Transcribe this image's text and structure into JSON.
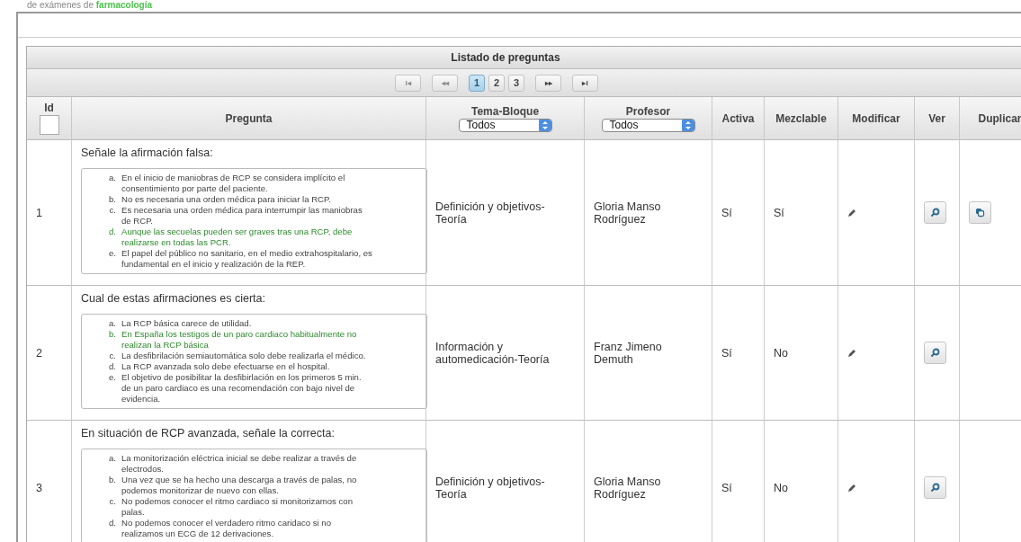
{
  "top_caption": {
    "text": "de exámenes de",
    "highlight": "farmacología"
  },
  "panel": {
    "title": "Listado de preguntas"
  },
  "pager": [
    {
      "kind": "first",
      "label": "I◂",
      "disabled": true
    },
    {
      "kind": "prev",
      "label": "◂◂",
      "disabled": true
    },
    {
      "kind": "page",
      "label": "1",
      "selected": true
    },
    {
      "kind": "page",
      "label": "2",
      "selected": false
    },
    {
      "kind": "page",
      "label": "3",
      "selected": false
    },
    {
      "kind": "next",
      "label": "▸▸",
      "disabled": false
    },
    {
      "kind": "last",
      "label": "▸I",
      "disabled": false
    }
  ],
  "columns": [
    {
      "kind": "id",
      "label": "Id"
    },
    {
      "kind": "text",
      "label": "Pregunta"
    },
    {
      "kind": "filter",
      "label": "Tema-Bloque",
      "value": "Todos"
    },
    {
      "kind": "filter",
      "label": "Profesor",
      "value": "Todos"
    },
    {
      "kind": "text",
      "label": "Activa"
    },
    {
      "kind": "text",
      "label": "Mezclable"
    },
    {
      "kind": "text",
      "label": "Modificar"
    },
    {
      "kind": "text",
      "label": "Ver"
    },
    {
      "kind": "text",
      "label": "Duplicar"
    }
  ],
  "rows": [
    {
      "id": "1",
      "question": "Señale la afirmación falsa:",
      "answers": [
        {
          "letter": "a.",
          "text": "En el inicio de maniobras de RCP se considera implícito el consentimiento por parte del paciente.",
          "correct": false
        },
        {
          "letter": "b.",
          "text": "No es necesaria una orden médica para iniciar la RCP.",
          "correct": false
        },
        {
          "letter": "c.",
          "text": "Es necesaria una orden médica para interrumpir las maniobras de RCP.",
          "correct": false
        },
        {
          "letter": "d.",
          "text": "Aunque las secuelas pueden ser graves tras una RCP, debe realizarse en todas las PCR.",
          "correct": true
        },
        {
          "letter": "e.",
          "text": "El papel del público no sanitario, en el medio extrahospitalario, es fundamental en el inicio y realización de la REP.",
          "correct": false
        }
      ],
      "tema": "Definición y objetivos-Teoría",
      "profesor": "Gloria Manso Rodríguez",
      "activa": "Sí",
      "mezclable": "Sí",
      "duplicable": true
    },
    {
      "id": "2",
      "question": "Cual de estas afirmaciones es cierta:",
      "answers": [
        {
          "letter": "a.",
          "text": "La RCP básica carece de utilidad.",
          "correct": false
        },
        {
          "letter": "b.",
          "text": "En España los testigos de un paro cardiaco habitualmente no realizan la RCP básica",
          "correct": true
        },
        {
          "letter": "c.",
          "text": "La desfibrilación semiautomática solo debe realizarla el médico.",
          "correct": false
        },
        {
          "letter": "d.",
          "text": "La RCP avanzada solo debe efectuarse en el hospital.",
          "correct": false
        },
        {
          "letter": "e.",
          "text": "El objetivo de posibilitar la desfibirlación en los primeros 5 min. de un paro cardiaco es una recomendación con bajo nivel de evidencia.",
          "correct": false
        }
      ],
      "tema": "Información y automedicación-Teoría",
      "profesor": "Franz Jimeno Demuth",
      "activa": "Sí",
      "mezclable": "No",
      "duplicable": false
    },
    {
      "id": "3",
      "question": "En situación de RCP avanzada, señale la correcta:",
      "answers": [
        {
          "letter": "a.",
          "text": "La monitorización eléctrica inicial se debe realizar a través de electrodos.",
          "correct": false
        },
        {
          "letter": "b.",
          "text": "Una vez que se ha hecho una descarga a través de palas, no podemos monitorizar de nuevo con ellas.",
          "correct": false
        },
        {
          "letter": "c.",
          "text": "No podemos conocer el ritmo cardiaco si monitorizamos con palas.",
          "correct": false
        },
        {
          "letter": "d.",
          "text": "No podemos conocer el verdadero ritmo caridaco si no realizamos un ECG de 12 derivaciones.",
          "correct": false
        }
      ],
      "tema": "Definición y objetivos-Teoría",
      "profesor": "Gloria Manso Rodríguez",
      "activa": "Sí",
      "mezclable": "No",
      "duplicable": false
    }
  ]
}
